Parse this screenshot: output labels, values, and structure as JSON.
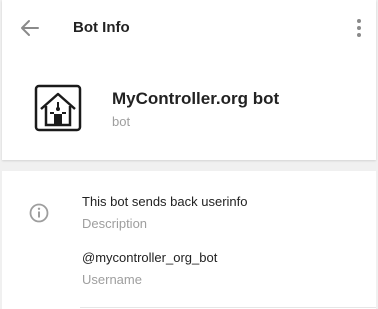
{
  "header": {
    "title": "Bot Info",
    "back_icon": "arrow-left-icon",
    "menu_icon": "more-vertical-icon"
  },
  "profile": {
    "name": "MyController.org bot",
    "status": "bot",
    "avatar_icon": "house-logo-icon"
  },
  "info": {
    "icon": "info-icon",
    "description_value": "This bot sends back userinfo",
    "description_label": "Description",
    "username_value": "@mycontroller_org_bot",
    "username_label": "Username"
  },
  "colors": {
    "background": "#f0f0f0",
    "card": "#ffffff",
    "text_primary": "#222222",
    "text_secondary": "#9e9e9e",
    "icon": "#8a8a8a"
  }
}
